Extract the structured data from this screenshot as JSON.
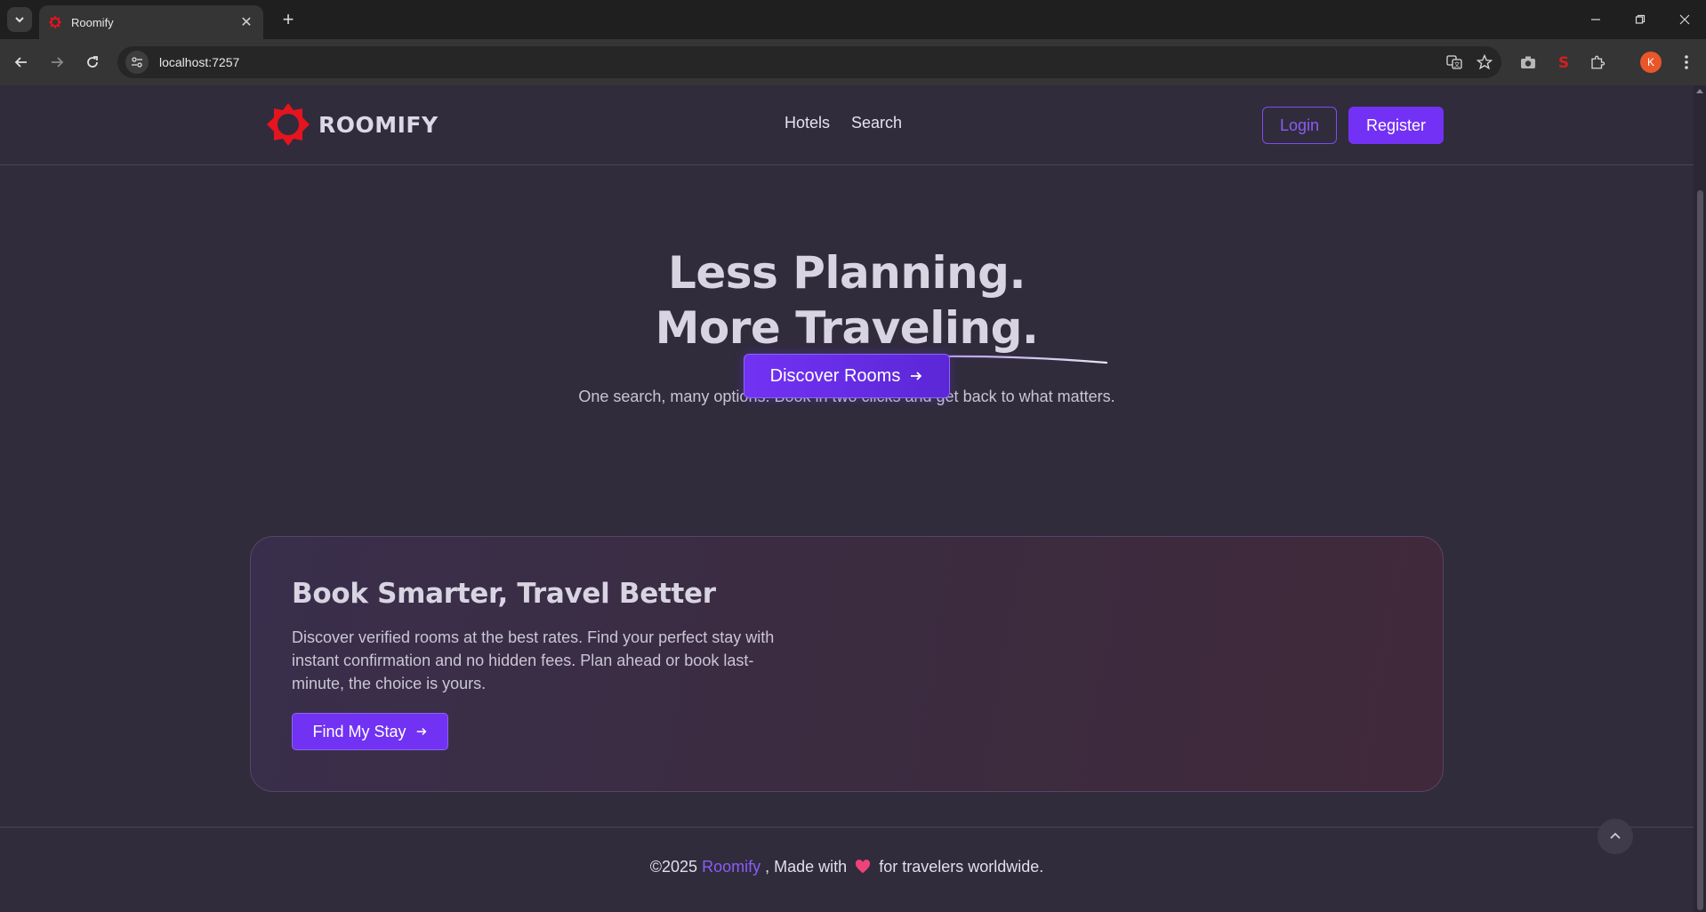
{
  "browser": {
    "tab_title": "Roomify",
    "url": "localhost:7257",
    "profile_initial": "K"
  },
  "site": {
    "brand": "ROOMIFY",
    "nav": {
      "hotels": "Hotels",
      "search": "Search"
    },
    "login": "Login",
    "register": "Register"
  },
  "hero": {
    "title_line1": "Less Planning.",
    "title_line2": "More Traveling.",
    "subtitle": "One search, many options. Book in two clicks and get back to what matters.",
    "cta": "Discover Rooms"
  },
  "promo": {
    "title": "Book Smarter, Travel Better",
    "text": "Discover verified rooms at the best rates. Find your perfect stay with instant confirmation and no hidden fees. Plan ahead or book last-minute, the choice is yours.",
    "cta": "Find My Stay"
  },
  "footer": {
    "prefix": "©2025",
    "brand": "Roomify",
    "middle": ", Made with",
    "suffix": "for travelers worldwide."
  },
  "colors": {
    "accent": "#7431f6",
    "brand_red": "#e5141e",
    "page_bg": "#302c3c"
  },
  "icons": [
    "chevron-down-icon",
    "close-icon",
    "plus-icon",
    "back-arrow-icon",
    "forward-arrow-icon",
    "reload-icon",
    "site-info-icon",
    "translate-icon",
    "star-icon",
    "camera-icon",
    "extension-icon",
    "puzzle-icon",
    "menu-dots-icon",
    "arrow-right-icon",
    "heart-icon",
    "chevron-up-icon"
  ]
}
